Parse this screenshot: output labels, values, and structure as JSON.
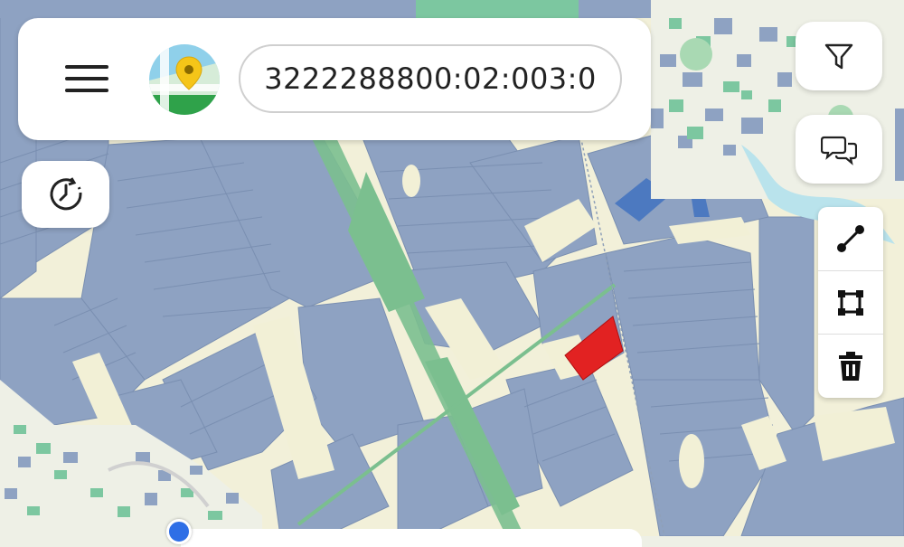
{
  "header": {
    "cadastral_number": "3222288800:02:003:0"
  },
  "icons": {
    "menu": "hamburger-menu-icon",
    "logo": "map-pin-logo-icon",
    "history": "clock-history-icon",
    "filter": "filter-funnel-icon",
    "chat": "chat-bubbles-icon",
    "measure_line": "line-measure-icon",
    "measure_area": "polygon-area-icon",
    "delete": "trash-icon"
  },
  "colors": {
    "parcel": "#8ea2c2",
    "parcel_dark": "#4c79c0",
    "selected_parcel": "#e22222",
    "road": "#f2f0d6",
    "forest_strip": "#7bbf8f",
    "background": "#eef0e6"
  }
}
